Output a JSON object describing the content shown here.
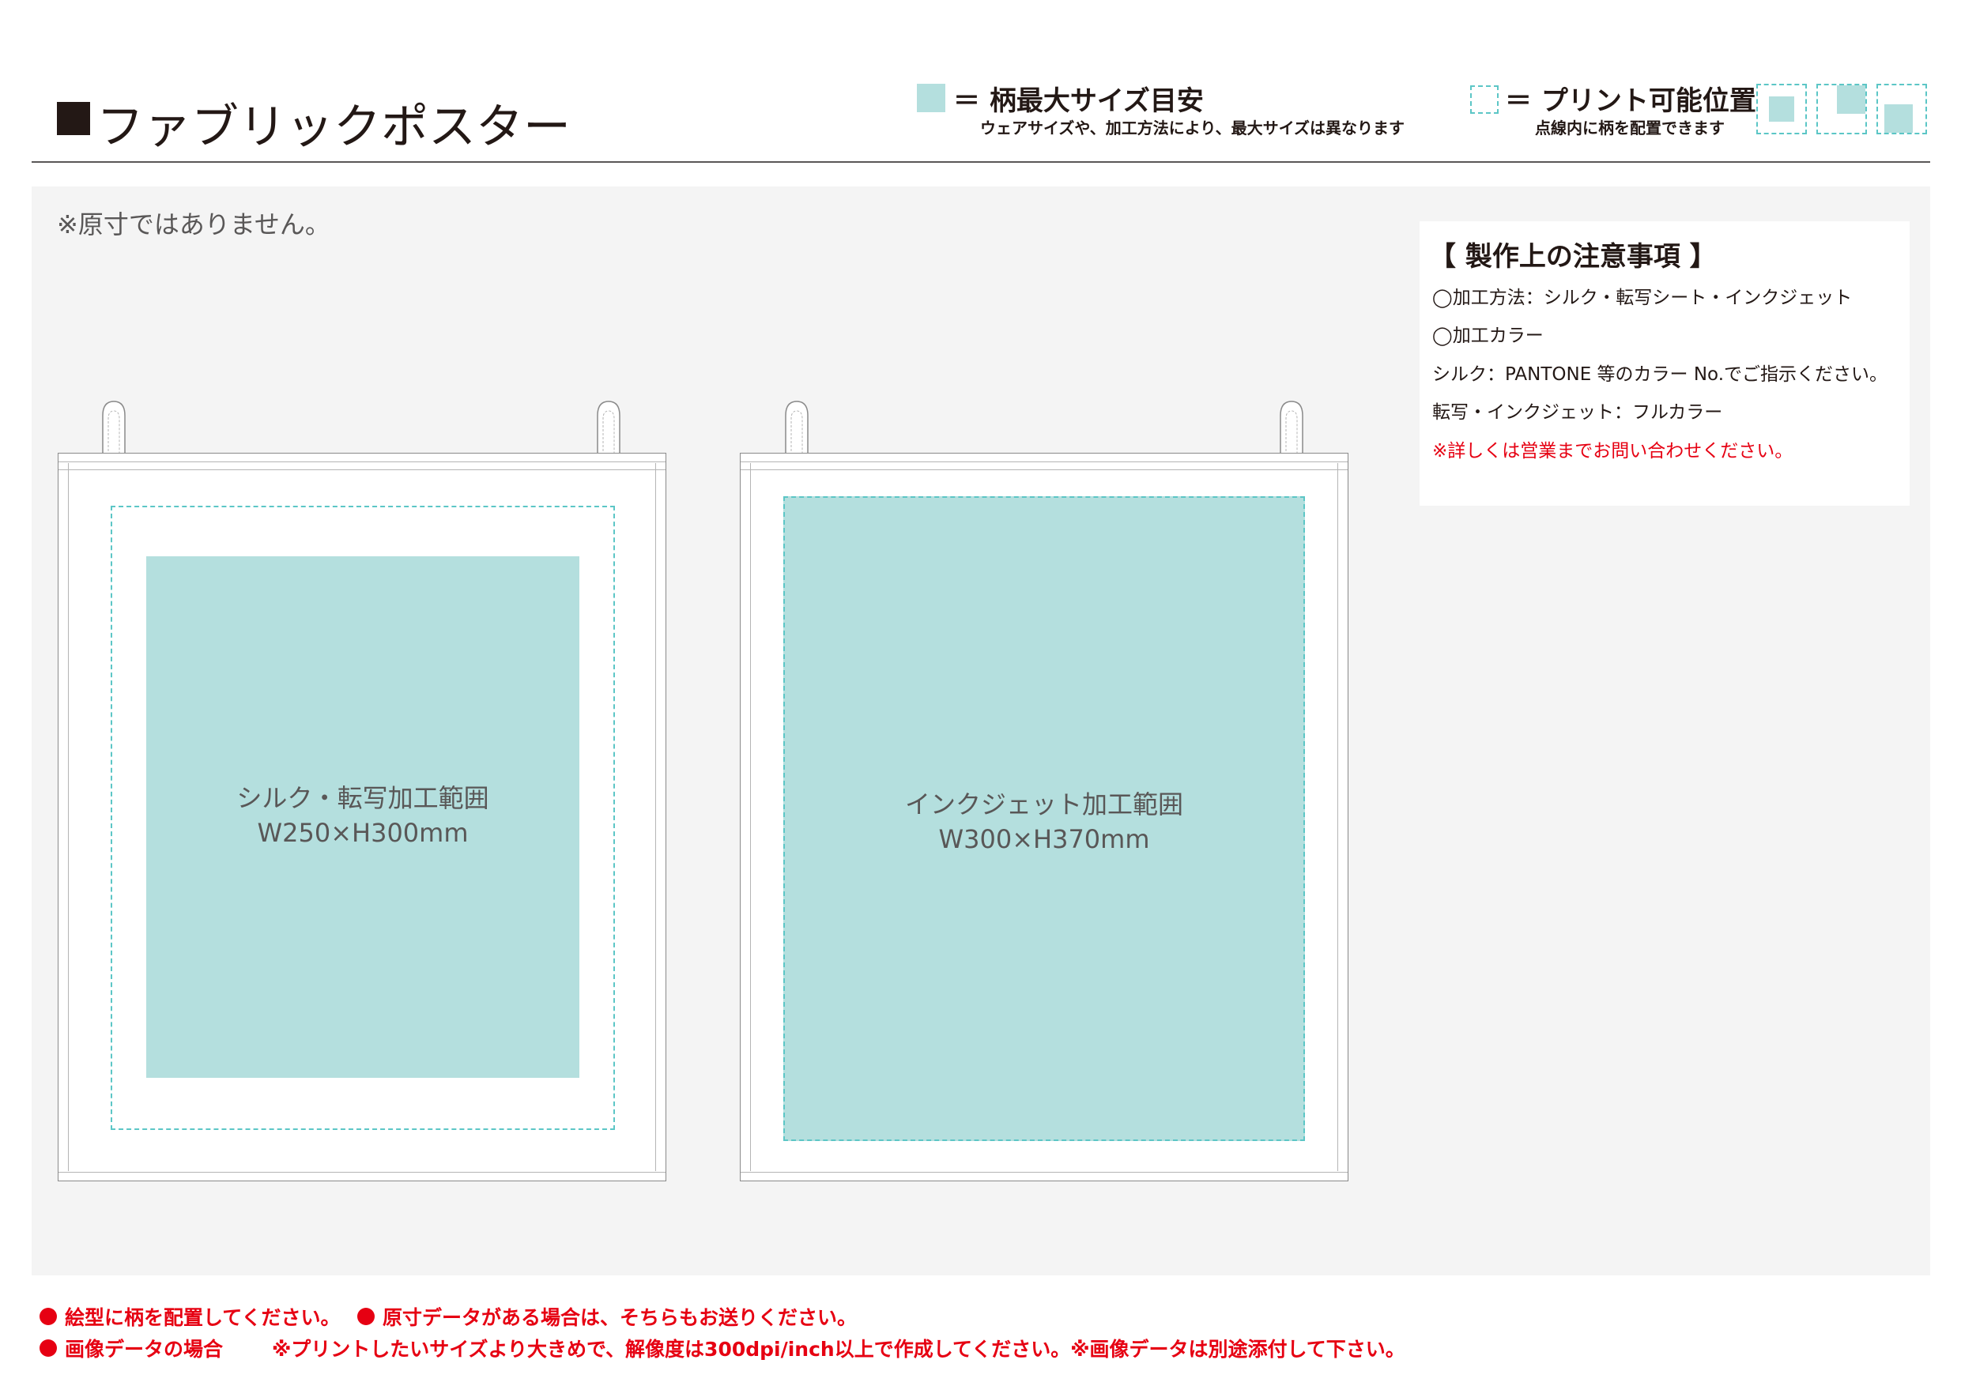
{
  "header": {
    "title": "ファブリックポスター",
    "legend_max": {
      "title": "＝ 柄最大サイズ目安",
      "note": "ウェアサイズや、加工方法により、最大サイズは異なります"
    },
    "legend_printable": {
      "title": "＝ プリント可能位置",
      "note": "点線内に柄を配置できます"
    }
  },
  "main": {
    "not_actual_size": "※原寸ではありません。",
    "posters": [
      {
        "label": "シルク・転写加工範囲",
        "size": "W250×H300mm"
      },
      {
        "label": "インクジェット加工範囲",
        "size": "W300×H370mm"
      }
    ]
  },
  "notes": {
    "title": "【 製作上の注意事項 】",
    "lines": [
      "◯加工方法：シルク・転写シート・インクジェット",
      "◯加工カラー",
      "シルク：PANTONE 等のカラー No.でご指示ください。",
      "転写・インクジェット：フルカラー"
    ],
    "warning": "※詳しくは営業までお問い合わせください。"
  },
  "footer": {
    "line1_a": "絵型に柄を配置してください。",
    "line1_b": "原寸データがある場合は、そちらもお送りください。",
    "line2_a": "画像データの場合",
    "line2_b": "※プリントしたいサイズより大きめで、解像度は300dpi/inch以上で作成してください。※画像データは別途添付して下さい。"
  },
  "colors": {
    "print_area": "#b4dfde",
    "dashed_outline": "#5cc6c6",
    "accent_red": "#e60012",
    "text_dark": "#231815"
  }
}
